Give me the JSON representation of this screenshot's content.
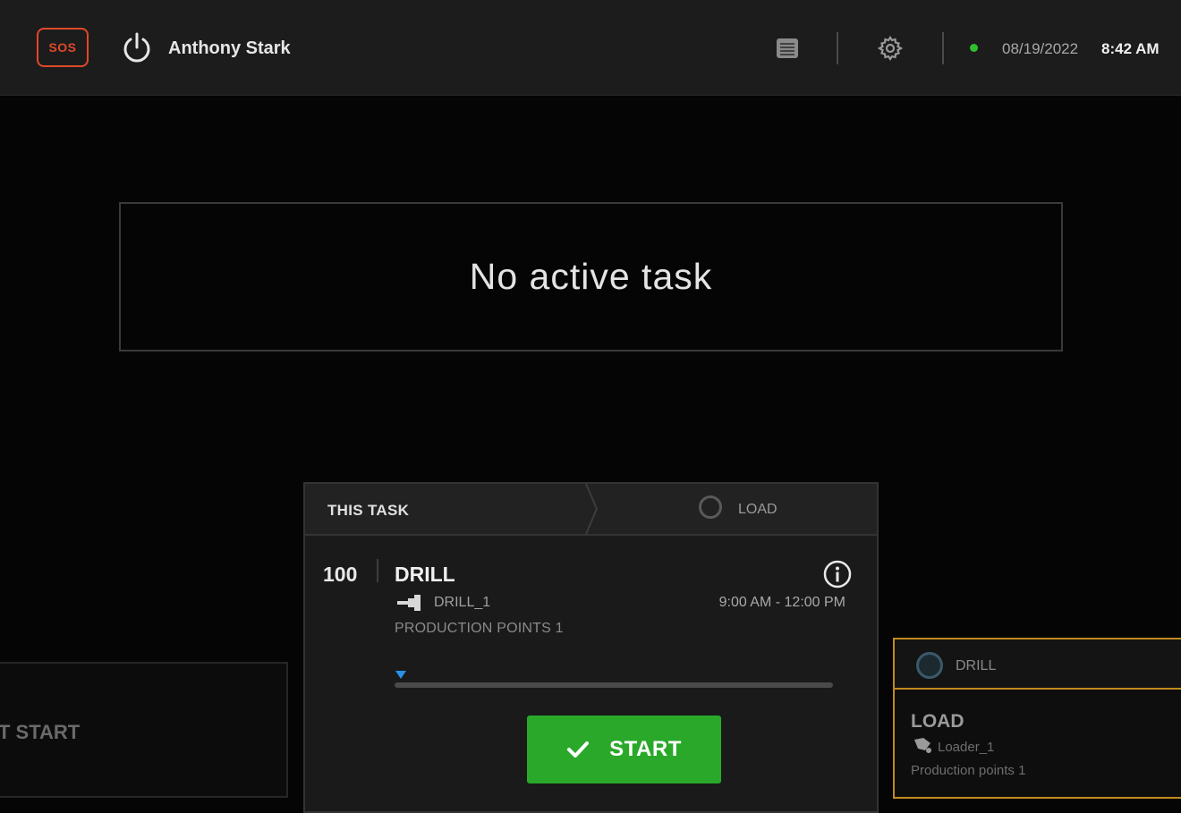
{
  "header": {
    "sos_label": "SOS",
    "user_name": "Anthony Stark",
    "date": "08/19/2022",
    "time": "8:42 AM",
    "status_color": "#2fc02f",
    "icons": [
      "power-icon",
      "menu-list-icon",
      "gear-icon"
    ]
  },
  "main": {
    "no_active_task": "No active task"
  },
  "left_card": {
    "label": "T START"
  },
  "task_card": {
    "tab_this_task": "THIS TASK",
    "tab_next": "LOAD",
    "number": "100",
    "name": "DRILL",
    "tool": "DRILL_1",
    "time_range": "9:00 AM - 12:00 PM",
    "production_points": "PRODUCTION POINTS 1",
    "progress": 0,
    "start_label": "START",
    "start_color": "#2aa82a"
  },
  "right_card": {
    "head_label": "DRILL",
    "title": "LOAD",
    "tool": "Loader_1",
    "production_points": "Production points 1",
    "border_color": "#c18a1e"
  }
}
